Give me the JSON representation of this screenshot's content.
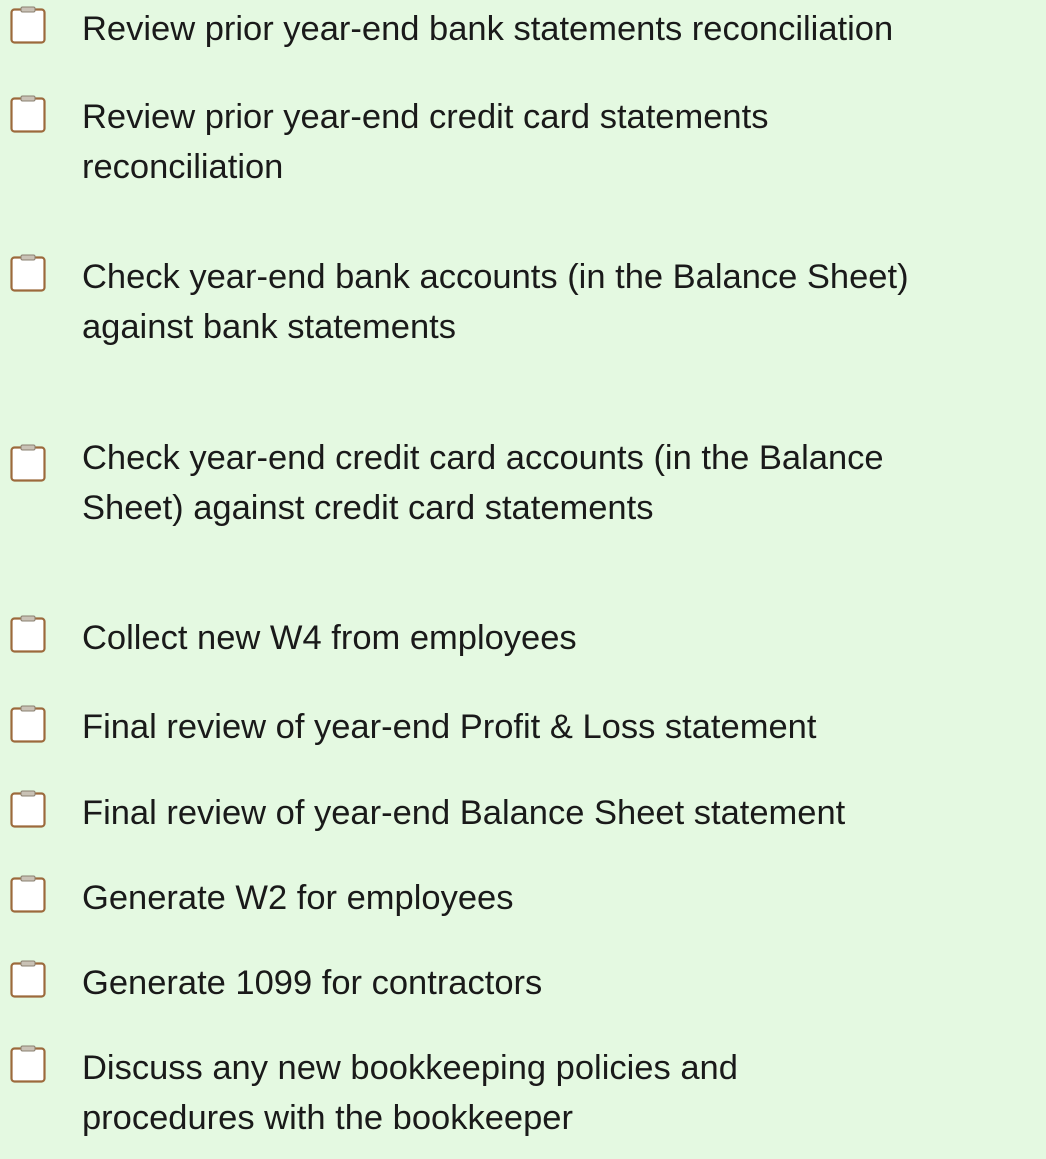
{
  "checklist": {
    "items": [
      {
        "lines": [
          "Review prior year-end bank statements reconciliation"
        ]
      },
      {
        "lines": [
          "Review prior year-end credit card statements",
          "reconciliation"
        ]
      },
      {
        "lines": [
          "Check year-end bank accounts (in the Balance Sheet)",
          "against bank statements"
        ]
      },
      {
        "lines": [
          "Check year-end credit card accounts (in the Balance",
          "Sheet) against credit card statements"
        ]
      },
      {
        "lines": [
          "Collect new W4 from employees"
        ]
      },
      {
        "lines": [
          "Final review of year-end Profit & Loss statement"
        ]
      },
      {
        "lines": [
          "Final review of year-end Balance Sheet statement"
        ]
      },
      {
        "lines": [
          "Generate W2 for employees"
        ]
      },
      {
        "lines": [
          "Generate 1099 for contractors"
        ]
      },
      {
        "lines": [
          "Discuss any new bookkeeping policies and",
          "procedures with the bookkeeper"
        ]
      }
    ],
    "checkbox_icon": "clipboard-checkbox-icon",
    "colors": {
      "background": "#e4f9e1",
      "text": "#1a1a1a",
      "checkbox_border": "#9c6a3c",
      "checkbox_fill": "#ffffff"
    }
  }
}
